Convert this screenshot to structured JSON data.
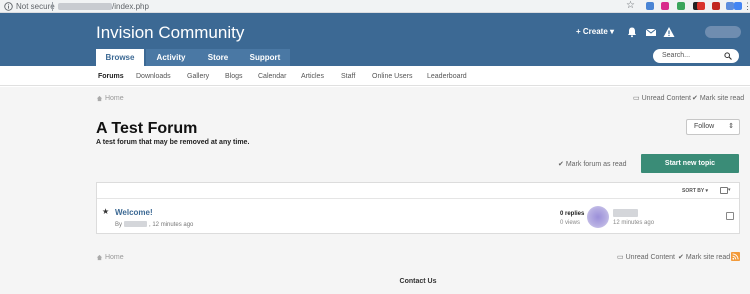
{
  "browser": {
    "security_label": "Not secure",
    "url_path": "/index.php",
    "menu_glyph": "⋮",
    "extensions": [
      {
        "name": "translate-ext-icon",
        "color": "#4a84d4"
      },
      {
        "name": "pocket-ext-icon",
        "color": "#d82a8c"
      },
      {
        "name": "android-ext-icon",
        "color": "#3aa55b"
      },
      {
        "name": "dark-ext-icon",
        "color": "#222222"
      },
      {
        "name": "adblock-ext-icon",
        "color": "#d9332b"
      },
      {
        "name": "lastpass-ext-icon",
        "color": "#c2271e"
      },
      {
        "name": "bookmark-ext-icon",
        "color": "#5c8ddd"
      },
      {
        "name": "gmail-ext-icon",
        "color": "#4285f4"
      }
    ]
  },
  "header": {
    "site_title": "Invision Community",
    "create_label": "+ Create ▾",
    "search_placeholder": "Search...",
    "tabs": [
      {
        "label": "Browse",
        "active": true
      },
      {
        "label": "Activity",
        "active": false
      },
      {
        "label": "Store",
        "active": false
      },
      {
        "label": "Support",
        "active": false
      }
    ]
  },
  "subnav": {
    "items": [
      "Forums",
      "Downloads",
      "Gallery",
      "Blogs",
      "Calendar",
      "Articles",
      "Staff",
      "Online Users",
      "Leaderboard"
    ]
  },
  "breadcrumb": {
    "home_label": "Home"
  },
  "utilities": {
    "unread_content": "Unread Content",
    "mark_site_read": "Mark site read"
  },
  "forum": {
    "title": "A Test Forum",
    "description": "A test forum that may be removed at any time.",
    "follow_label": "Follow",
    "mark_forum_read": "Mark forum as read",
    "new_topic_label": "Start new topic"
  },
  "list": {
    "sort_label": "SORT BY ▾",
    "topics": [
      {
        "title": "Welcome!",
        "by_prefix": "By",
        "time": ", 12 minutes ago",
        "replies": "0 replies",
        "views": "0 views",
        "last_time": "12 minutes ago"
      }
    ]
  },
  "footer": {
    "contact_label": "Contact Us"
  },
  "colors": {
    "header_bg": "#3c6994",
    "accent_green": "#3a8c77",
    "link_blue": "#3c6994"
  }
}
